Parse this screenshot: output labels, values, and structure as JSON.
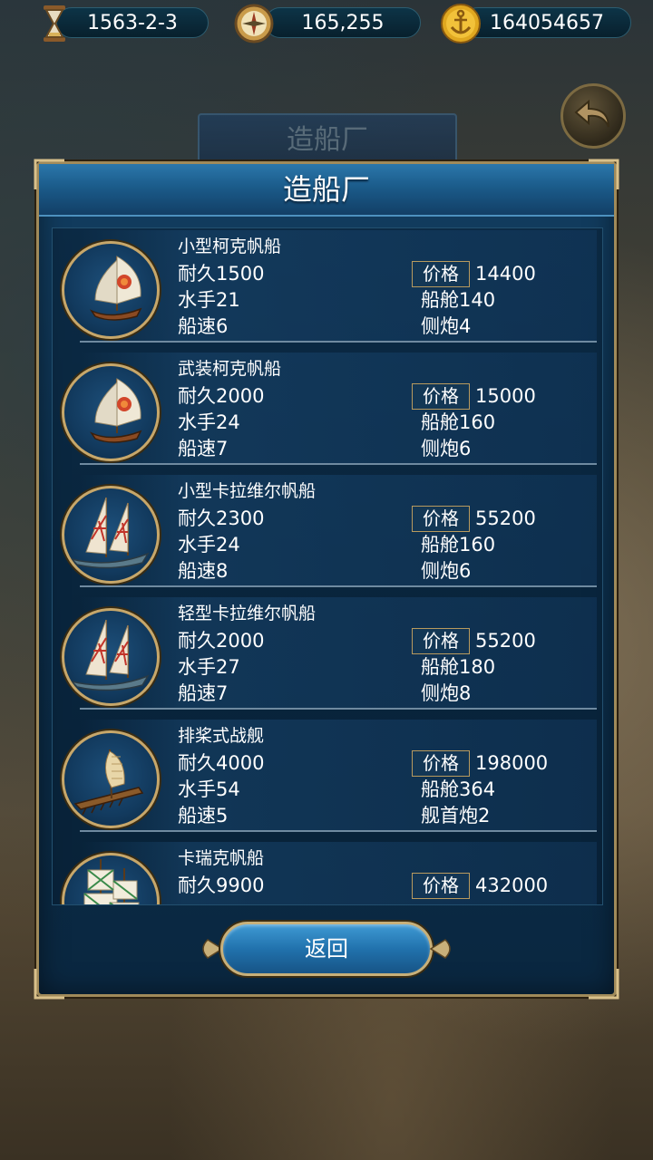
{
  "status_bar": {
    "date": "1563-2-3",
    "compass_value": "165,255",
    "gold": "164054657",
    "date_icon": "hourglass-icon",
    "compass_icon": "compass-icon",
    "gold_icon": "anchor-coin-icon"
  },
  "background": {
    "ghost_title": "造船厂"
  },
  "dialog": {
    "title": "造船厂",
    "return_label": "返回"
  },
  "ships": [
    {
      "name": "小型柯克帆船",
      "durability_label": "耐久",
      "durability": "1500",
      "crew_label": "水手",
      "crew": "21",
      "speed_label": "船速",
      "speed": "6",
      "price_label": "价格",
      "price": "14400",
      "cabin_label": "船舱",
      "cabin": "140",
      "cannon_label": "侧炮",
      "cannon": "4",
      "icon": "cog-ship-icon"
    },
    {
      "name": "武装柯克帆船",
      "durability_label": "耐久",
      "durability": "2000",
      "crew_label": "水手",
      "crew": "24",
      "speed_label": "船速",
      "speed": "7",
      "price_label": "价格",
      "price": "15000",
      "cabin_label": "船舱",
      "cabin": "160",
      "cannon_label": "侧炮",
      "cannon": "6",
      "icon": "cog-ship-icon"
    },
    {
      "name": "小型卡拉维尔帆船",
      "durability_label": "耐久",
      "durability": "2300",
      "crew_label": "水手",
      "crew": "24",
      "speed_label": "船速",
      "speed": "8",
      "price_label": "价格",
      "price": "55200",
      "cabin_label": "船舱",
      "cabin": "160",
      "cannon_label": "侧炮",
      "cannon": "6",
      "icon": "caravel-ship-icon"
    },
    {
      "name": "轻型卡拉维尔帆船",
      "durability_label": "耐久",
      "durability": "2000",
      "crew_label": "水手",
      "crew": "27",
      "speed_label": "船速",
      "speed": "7",
      "price_label": "价格",
      "price": "55200",
      "cabin_label": "船舱",
      "cabin": "180",
      "cannon_label": "侧炮",
      "cannon": "8",
      "icon": "caravel-ship-icon"
    },
    {
      "name": "排桨式战舰",
      "durability_label": "耐久",
      "durability": "4000",
      "crew_label": "水手",
      "crew": "54",
      "speed_label": "船速",
      "speed": "5",
      "price_label": "价格",
      "price": "198000",
      "cabin_label": "船舱",
      "cabin": "364",
      "cannon_label": "舰首炮",
      "cannon": "2",
      "icon": "galley-ship-icon"
    },
    {
      "name": "卡瑞克帆船",
      "durability_label": "耐久",
      "durability": "9900",
      "price_label": "价格",
      "price": "432000",
      "icon": "carrack-ship-icon"
    }
  ],
  "colors": {
    "panel": "#0c2f4c",
    "header": "#1b5b8a",
    "gold_border": "#c7a76a",
    "button": "#2172ad"
  }
}
